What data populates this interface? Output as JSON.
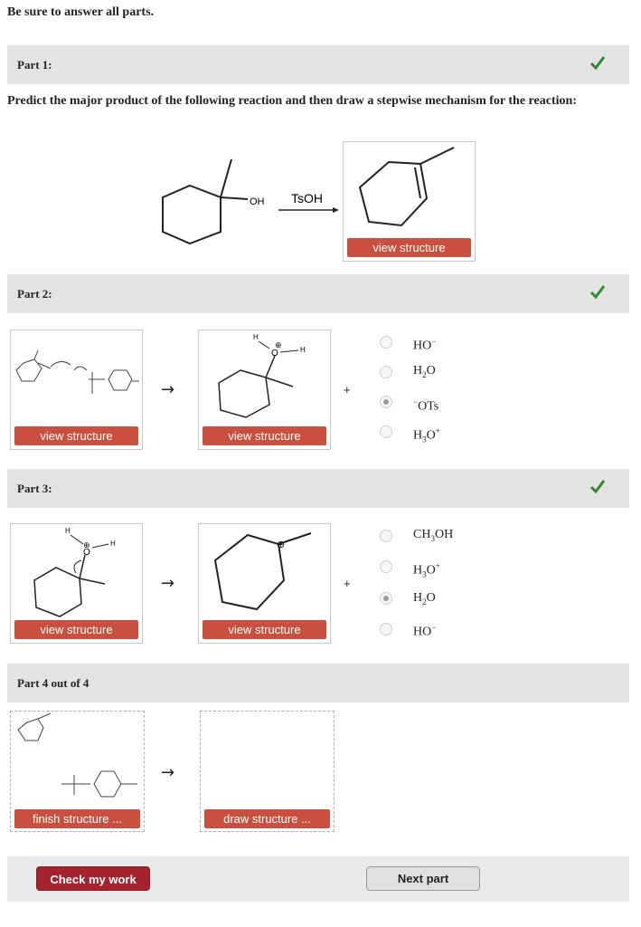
{
  "instruction": "Be sure to answer all parts.",
  "colors": {
    "accent_red": "#c9503f",
    "check_green": "#2f8a2f",
    "bar_gray": "#e3e3e3",
    "dark_red_button": "#a4232f"
  },
  "part1": {
    "label": "Part 1:",
    "question": "Predict the major product of the following reaction and then draw a stepwise mechanism for the reaction:",
    "oh_label": "OH",
    "reagent": "TsOH",
    "view_btn": "view structure"
  },
  "part2": {
    "label": "Part 2:",
    "view_btn_1": "view structure",
    "view_btn_2": "view structure",
    "arrow": "→",
    "plus": "+",
    "atom_h1": "H",
    "atom_o": "O",
    "atom_h2": "H",
    "charge": "⊕",
    "options": [
      {
        "main": "HO",
        "sup": "−",
        "selected": false
      },
      {
        "main": "H",
        "sub": "2",
        "tail": "O",
        "selected": false
      },
      {
        "pre": "−",
        "main": "OTs",
        "selected": true
      },
      {
        "main": "H",
        "sub": "3",
        "tail": "O",
        "sup": "+",
        "selected": false
      }
    ]
  },
  "part3": {
    "label": "Part 3:",
    "view_btn_1": "view structure",
    "view_btn_2": "view structure",
    "arrow": "→",
    "plus": "+",
    "atom_h1": "H",
    "atom_o": "O",
    "atom_h2": "H",
    "charge": "⊕",
    "options": [
      {
        "main": "CH",
        "sub": "3",
        "tail": "OH",
        "selected": false
      },
      {
        "main": "H",
        "sub": "3",
        "tail": "O",
        "sup": "+",
        "selected": false
      },
      {
        "main": "H",
        "sub": "2",
        "tail": "O",
        "selected": true
      },
      {
        "main": "HO",
        "sup": "−",
        "selected": false
      }
    ]
  },
  "part4": {
    "label": "Part 4 out of 4",
    "finish_btn": "finish structure ...",
    "draw_btn": "draw structure ...",
    "arrow": "→"
  },
  "footer": {
    "check_btn": "Check my work",
    "next_btn": "Next part"
  }
}
